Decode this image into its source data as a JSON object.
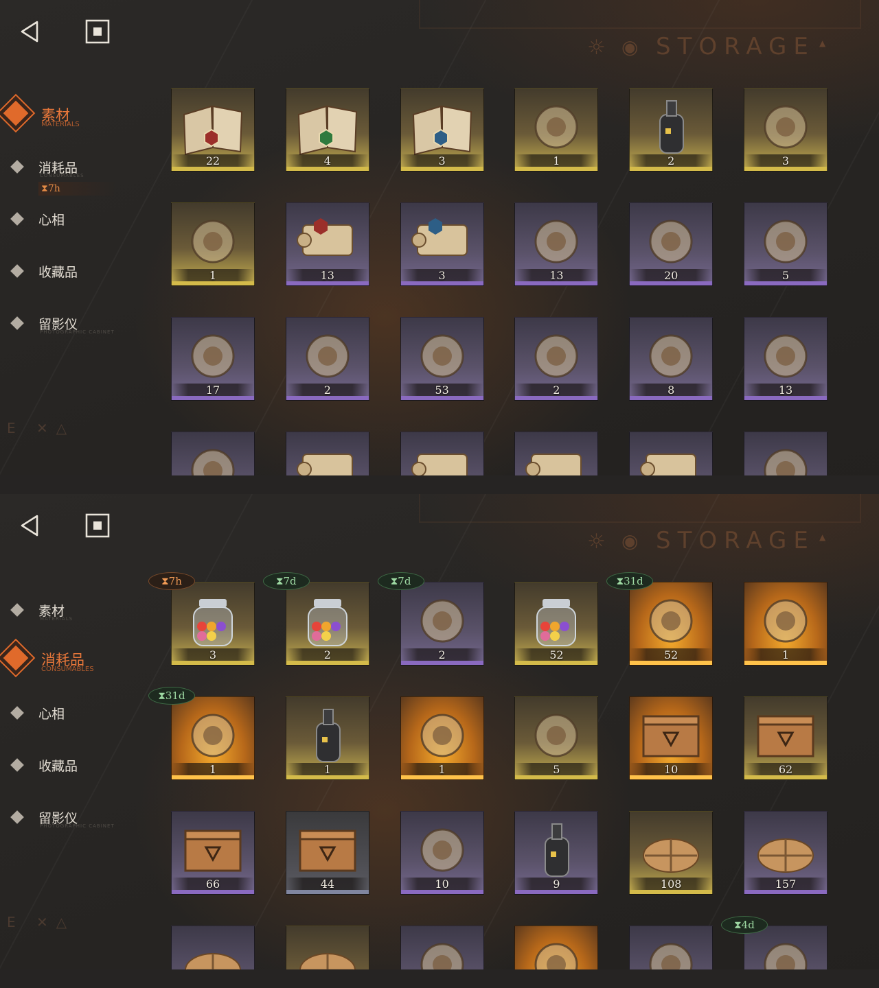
{
  "panels": [
    {
      "nav": {
        "back_icon": "back-triangle-icon",
        "home_icon": "square-home-icon",
        "items": [
          {
            "label": "素材",
            "sub": "MATERIALS",
            "active": true
          },
          {
            "label": "消耗品",
            "sub": "CONSUMABLES",
            "active": false
          },
          {
            "label": "心相",
            "sub": "",
            "active": false
          },
          {
            "label": "收藏品",
            "sub": "",
            "active": false
          },
          {
            "label": "留影仪",
            "sub": "PHOTOGRAPHIC CABINET",
            "active": false
          }
        ],
        "consumables_timer": "⧗7h"
      },
      "header": {
        "title": "STORAGE"
      },
      "items": [
        {
          "count": "22",
          "rarity": "gold",
          "icon": "spellbook-red-icon"
        },
        {
          "count": "4",
          "rarity": "gold",
          "icon": "spellbook-green-icon"
        },
        {
          "count": "3",
          "rarity": "gold",
          "icon": "spellbook-blue-icon"
        },
        {
          "count": "1",
          "rarity": "gold",
          "icon": "ouija-board-icon"
        },
        {
          "count": "2",
          "rarity": "gold",
          "icon": "potion-bottle-icon"
        },
        {
          "count": "3",
          "rarity": "gold",
          "icon": "firefly-icon"
        },
        {
          "count": "1",
          "rarity": "gold",
          "icon": "hand-case-icon"
        },
        {
          "count": "13",
          "rarity": "purple",
          "icon": "scroll-red-icon"
        },
        {
          "count": "3",
          "rarity": "purple",
          "icon": "scroll-blue-icon"
        },
        {
          "count": "13",
          "rarity": "purple",
          "icon": "scarab-amulet-icon"
        },
        {
          "count": "20",
          "rarity": "purple",
          "icon": "crystal-pendulum-icon"
        },
        {
          "count": "5",
          "rarity": "purple",
          "icon": "stone-tablet-icon"
        },
        {
          "count": "17",
          "rarity": "purple",
          "icon": "coffin-case-icon"
        },
        {
          "count": "2",
          "rarity": "purple",
          "icon": "brass-device-icon"
        },
        {
          "count": "53",
          "rarity": "purple",
          "icon": "winged-key-icon"
        },
        {
          "count": "2",
          "rarity": "purple",
          "icon": "bird-figurine-icon"
        },
        {
          "count": "8",
          "rarity": "purple",
          "icon": "silver-bar-icon"
        },
        {
          "count": "13",
          "rarity": "purple",
          "icon": "skeleton-specimen-icon"
        },
        {
          "count": "",
          "rarity": "purple",
          "icon": "flower-plant-icon"
        },
        {
          "count": "",
          "rarity": "purple",
          "icon": "paper-scroll-icon"
        },
        {
          "count": "",
          "rarity": "purple",
          "icon": "paper-scroll-icon"
        },
        {
          "count": "",
          "rarity": "purple",
          "icon": "paper-scroll-icon"
        },
        {
          "count": "",
          "rarity": "purple",
          "icon": "paper-scroll-icon"
        },
        {
          "count": "",
          "rarity": "purple",
          "icon": "ornate-staff-icon"
        }
      ]
    },
    {
      "nav": {
        "back_icon": "back-triangle-icon",
        "home_icon": "square-home-icon",
        "items": [
          {
            "label": "素材",
            "sub": "MATERIALS",
            "active": false
          },
          {
            "label": "消耗品",
            "sub": "CONSUMABLES",
            "active": true
          },
          {
            "label": "心相",
            "sub": "",
            "active": false
          },
          {
            "label": "收藏品",
            "sub": "",
            "active": false
          },
          {
            "label": "留影仪",
            "sub": "PHOTOGRAPHIC CABINET",
            "active": false
          }
        ]
      },
      "header": {
        "title": "STORAGE"
      },
      "items": [
        {
          "count": "3",
          "rarity": "gold",
          "icon": "candy-jar-icon",
          "timer": "⧗7h",
          "timer_color": "orange"
        },
        {
          "count": "2",
          "rarity": "gold",
          "icon": "candy-jar-icon",
          "timer": "⧗7d",
          "timer_color": "green"
        },
        {
          "count": "2",
          "rarity": "purple",
          "icon": "lollipop-icon",
          "timer": "⧗7d",
          "timer_color": "green"
        },
        {
          "count": "52",
          "rarity": "gold",
          "icon": "candy-jar-icon"
        },
        {
          "count": "52",
          "rarity": "orange",
          "icon": "rune-book-icon",
          "timer": "⧗31d",
          "timer_color": "green"
        },
        {
          "count": "1",
          "rarity": "orange",
          "icon": "photo-box-icon"
        },
        {
          "count": "1",
          "rarity": "orange",
          "icon": "mannequin-icon",
          "timer": "⧗31d",
          "timer_color": "green"
        },
        {
          "count": "1",
          "rarity": "gold",
          "icon": "message-bottle-icon"
        },
        {
          "count": "1",
          "rarity": "orange",
          "icon": "crystal-feather-icon"
        },
        {
          "count": "5",
          "rarity": "gold",
          "icon": "rune-table-icon"
        },
        {
          "count": "10",
          "rarity": "orange",
          "icon": "wooden-crate-icon"
        },
        {
          "count": "62",
          "rarity": "gold",
          "icon": "wooden-crate-icon"
        },
        {
          "count": "66",
          "rarity": "purple",
          "icon": "wooden-crate-icon"
        },
        {
          "count": "44",
          "rarity": "gray",
          "icon": "wooden-crate-icon"
        },
        {
          "count": "10",
          "rarity": "purple",
          "icon": "hourglass-icon"
        },
        {
          "count": "9",
          "rarity": "purple",
          "icon": "message-bottle-icon"
        },
        {
          "count": "108",
          "rarity": "gold",
          "icon": "parcel-icon"
        },
        {
          "count": "157",
          "rarity": "purple",
          "icon": "parcel-icon"
        },
        {
          "count": "",
          "rarity": "purple",
          "icon": "parcel-icon"
        },
        {
          "count": "",
          "rarity": "gold",
          "icon": "parcel-icon"
        },
        {
          "count": "",
          "rarity": "purple",
          "icon": "sand-castle-icon"
        },
        {
          "count": "",
          "rarity": "orange",
          "icon": "golden-frame-icon"
        },
        {
          "count": "",
          "rarity": "purple",
          "icon": "round-flask-icon"
        },
        {
          "count": "",
          "rarity": "purple",
          "icon": "gem-candy-icon",
          "timer": "⧗4d",
          "timer_color": "green"
        }
      ]
    }
  ],
  "colors": {
    "accent": "#e06a2b",
    "gold": "#d4bb4a",
    "purple": "#8a6ac0",
    "timer_green": "#9dd8a2",
    "timer_orange": "#f09a55"
  }
}
